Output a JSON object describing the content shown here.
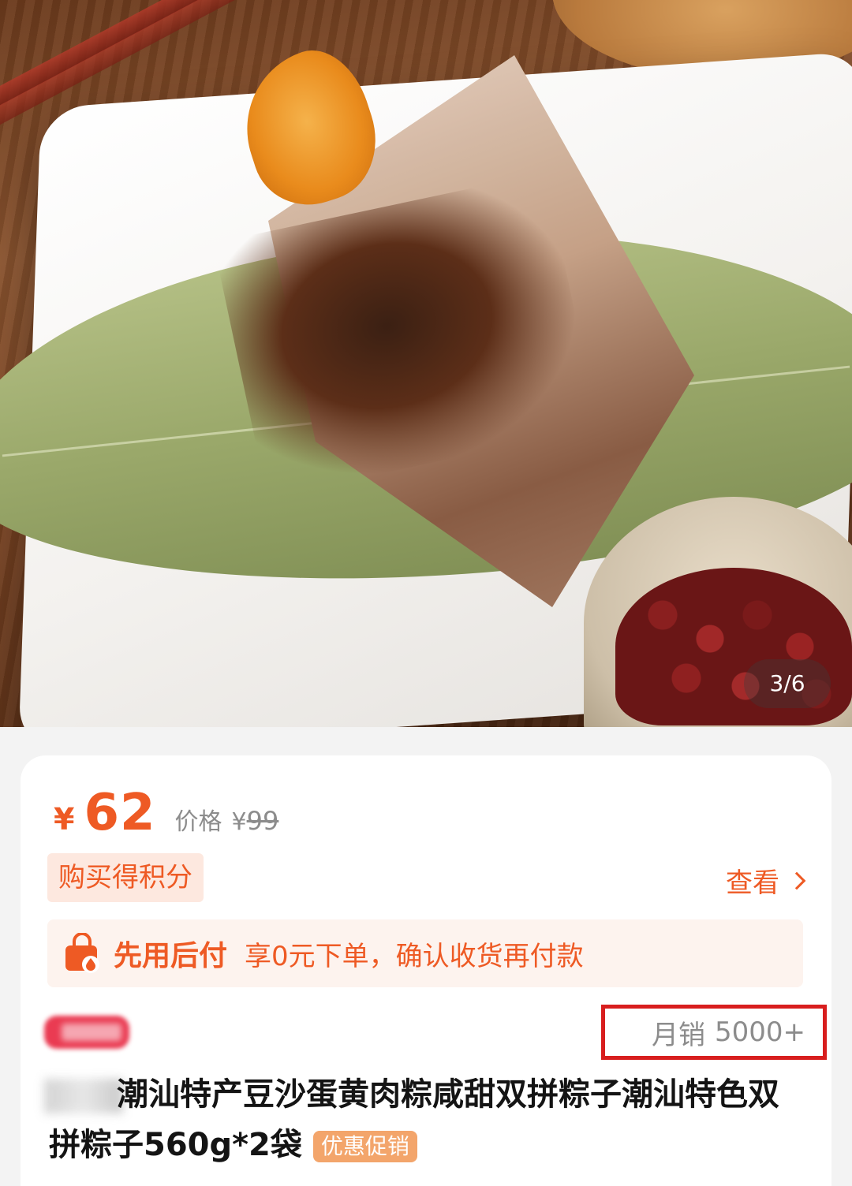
{
  "gallery": {
    "page_indicator": "3/6"
  },
  "price": {
    "currency_symbol": "¥",
    "current": "62",
    "original_label": "价格",
    "original_symbol": "¥",
    "original": "99"
  },
  "points": {
    "badge_label": "购买得积分",
    "view_label": "查看"
  },
  "pay_later": {
    "icon": "shopping-bag-icon",
    "title": "先用后付",
    "description": "享0元下单，确认收货再付款"
  },
  "sales": {
    "label": "月销",
    "value": "5000+"
  },
  "product": {
    "title": "潮汕特产豆沙蛋黄肉粽咸甜双拼粽子潮汕特色双拼粽子560g*2袋",
    "promo_badge": "优惠促销"
  },
  "colors": {
    "accent": "#ee5a24",
    "highlight_box": "#d81e1e",
    "promo_badge_bg": "#f3a56b"
  }
}
